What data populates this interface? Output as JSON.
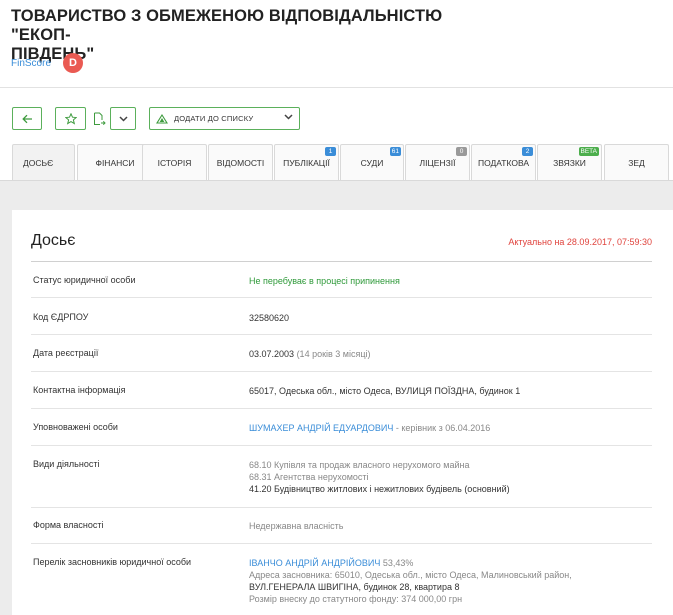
{
  "company": {
    "title_line1": "ТОВАРИСТВО З ОБМЕЖЕНОЮ ВІДПОВІДАЛЬНІСТЮ \"ЕКОП-",
    "title_line2": "ПІВДЕНЬ\"",
    "finscore_label": "FinScore",
    "finscore_grade": "D"
  },
  "toolbar": {
    "add_to_list_label": "Додати до списку",
    "icons": {
      "back": "arrow-left-icon",
      "favorite": "star-icon",
      "export": "document-export-icon",
      "dropdown": "chevron-down-icon",
      "list": "list-triangle-icon"
    }
  },
  "tabs": [
    {
      "label": "Досьє",
      "active": true
    },
    {
      "label": "Фінанси"
    },
    {
      "label": "Історія"
    },
    {
      "label": "Відомості"
    },
    {
      "label": "Публікації",
      "badge": "1"
    },
    {
      "label": "Суди",
      "badge": "61"
    },
    {
      "label": "Ліцензії",
      "badge": "0"
    },
    {
      "label": "Податкова",
      "badge": "2"
    },
    {
      "label": "Звязки",
      "badge": "beta"
    },
    {
      "label": "ЗЕД"
    }
  ],
  "colors": {
    "accent_green": "#5bb05b",
    "badge_blue": "#3a8dd8",
    "badge_gray": "#999999",
    "badge_green": "#4cae4c",
    "alert_red": "#e0443e",
    "finscore_red": "#ea5a52"
  },
  "dossier": {
    "title": "Досьє",
    "updated": "Актуально на 28.09.2017, 07:59:30",
    "rows": {
      "status": {
        "label": "Статус юридичної особи",
        "value": "Не перебуває в процесі припинення"
      },
      "code": {
        "label": "Код ЄДРПОУ",
        "value": "32580620"
      },
      "reg_date": {
        "label": "Дата реєстрації",
        "value": "03.07.2003",
        "note": "(14 років 3 місяці)"
      },
      "contact": {
        "label": "Контактна інформація",
        "value": "65017, Одеська обл., місто Одеса, ВУЛИЦЯ ПОЇЗДНА, будинок 1"
      },
      "authorized": {
        "label": "Уповноважені особи",
        "name": "ШУМАХЕР АНДРІЙ ЕДУАРДОВИЧ",
        "role": " - керівник з 06.04.2016"
      },
      "activities": {
        "label": "Види діяльності",
        "items": [
          "68.10 Купівля та продаж власного нерухомого майна",
          "68.31 Агентства нерухомості",
          "41.20 Будівництво житлових і нежитлових будівель (основний)"
        ]
      },
      "ownership": {
        "label": "Форма власності",
        "value": "Недержавна власність"
      },
      "founders": {
        "label": "Перелік засновників юридичної особи",
        "name": "ІВАНЧО АНДРІЙ АНДРІЙОВИЧ",
        "share": " 53,43%",
        "address_line1": "Адреса засновника: 65010, Одеська обл., місто Одеса, Малиновський район,",
        "address_line2": "ВУЛ.ГЕНЕРАЛА ШВИГІНА, будинок 28, квартира 8",
        "capital": "Розмір внеску до статутного фонду: 374 000,00 грн"
      }
    }
  }
}
